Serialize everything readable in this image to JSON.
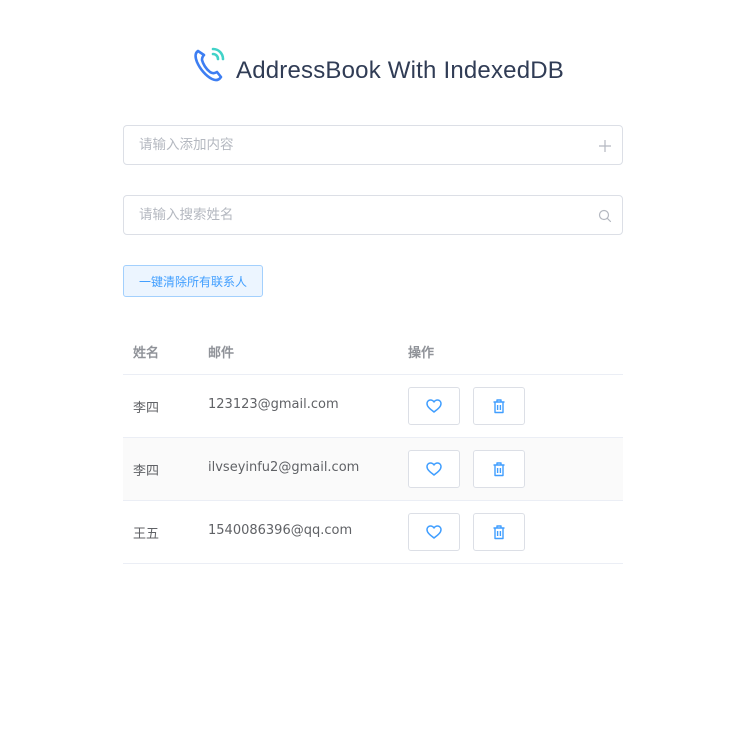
{
  "app": {
    "title": "AddressBook With IndexedDB",
    "logo_icon": "phone-icon"
  },
  "add_input": {
    "placeholder": "请输入添加内容",
    "value": "",
    "suffix_icon": "plus-icon"
  },
  "search_input": {
    "placeholder": "请输入搜索姓名",
    "value": "",
    "suffix_icon": "search-icon"
  },
  "clear_button": {
    "label": "一键清除所有联系人"
  },
  "table": {
    "headers": {
      "name": "姓名",
      "email": "邮件",
      "ops": "操作"
    },
    "rows": [
      {
        "name": "李四",
        "email": "123123@gmail.com"
      },
      {
        "name": "李四",
        "email": "ilvseyinfu2@gmail.com"
      },
      {
        "name": "王五",
        "email": "1540086396@qq.com"
      }
    ],
    "row_actions": [
      "heart-icon",
      "delete-icon"
    ]
  },
  "colors": {
    "accent": "#409eff",
    "title": "#303c55",
    "logo_blue": "#3d7ef2",
    "logo_teal": "#41d2c8",
    "border": "#dcdfe6"
  }
}
